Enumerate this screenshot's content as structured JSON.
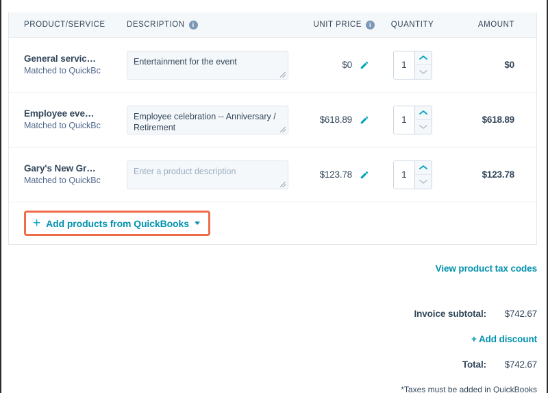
{
  "table": {
    "headers": {
      "product": "PRODUCT/SERVICE",
      "description": "DESCRIPTION",
      "unit_price": "UNIT PRICE",
      "quantity": "QUANTITY",
      "amount": "AMOUNT",
      "info_glyph": "i"
    },
    "rows": [
      {
        "name": "General servic…",
        "match": "Matched to QuickBc",
        "description": "Entertainment for the event",
        "description_is_placeholder": false,
        "unit_price": "$0",
        "quantity": "1",
        "amount": "$0"
      },
      {
        "name": "Employee eve…",
        "match": "Matched to QuickBc",
        "description": "Employee celebration -- Anniversary / Retirement",
        "description_is_placeholder": false,
        "unit_price": "$618.89",
        "quantity": "1",
        "amount": "$618.89"
      },
      {
        "name": "Gary's New Gr…",
        "match": "Matched to QuickBc",
        "description": "Enter a product description",
        "description_is_placeholder": true,
        "unit_price": "$123.78",
        "quantity": "1",
        "amount": "$123.78"
      }
    ],
    "add_products": {
      "plus": "+",
      "label": "Add products from QuickBooks"
    }
  },
  "links": {
    "view_tax_codes": "View product tax codes",
    "add_discount": "+ Add discount"
  },
  "summary": {
    "subtotal_label": "Invoice subtotal:",
    "subtotal_value": "$742.67",
    "total_label": "Total:",
    "total_value": "$742.67",
    "tax_note": "*Taxes must be added in QuickBooks"
  },
  "colors": {
    "accent_teal": "#0091ae",
    "icon_teal": "#00a4bd",
    "highlight_orange": "#ef6c4a",
    "text_dark": "#33475b",
    "text_muted": "#51688c",
    "header_bg": "#f5f8fa"
  }
}
